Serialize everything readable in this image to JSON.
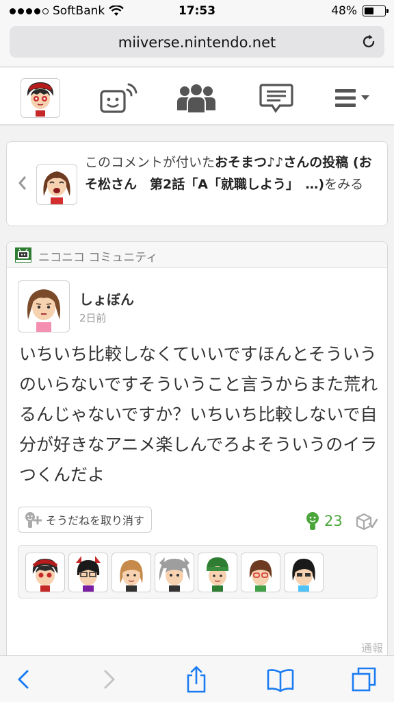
{
  "status_bar": {
    "carrier": "SoftBank",
    "time": "17:53",
    "battery_percent_label": "48%",
    "battery_level": 0.48,
    "signal_bars_filled": 4,
    "signal_bars_total": 5
  },
  "browser": {
    "url": "miiverse.nintendo.net"
  },
  "nav": {
    "items": [
      "my-page",
      "activity-feed",
      "communities",
      "messages",
      "menu"
    ]
  },
  "back_link": {
    "prefix": "このコメントが付いた",
    "bold": "おそまつ♪♪さんの投稿 (おそ松さん　第2話「A「就職しよう」　…)",
    "suffix": "をみる"
  },
  "post": {
    "community_name": "ニコニコ コミュニティ",
    "author_name": "しょぼん",
    "timestamp": "2日前",
    "body": "いちいち比較しなくていいですほんとそういうのいらないですそういうこと言うからまた荒れるんじゃないですか？いちいち比較しないで自分が好きなアニメ楽しんでろよそういうのイラつくんだよ",
    "yeah_button_label": "そうだねを取り消す",
    "yeah_count": "23",
    "report_label": "通報"
  },
  "colors": {
    "yeah_green": "#4aa63a",
    "link_blue": "#1a7bf2"
  }
}
